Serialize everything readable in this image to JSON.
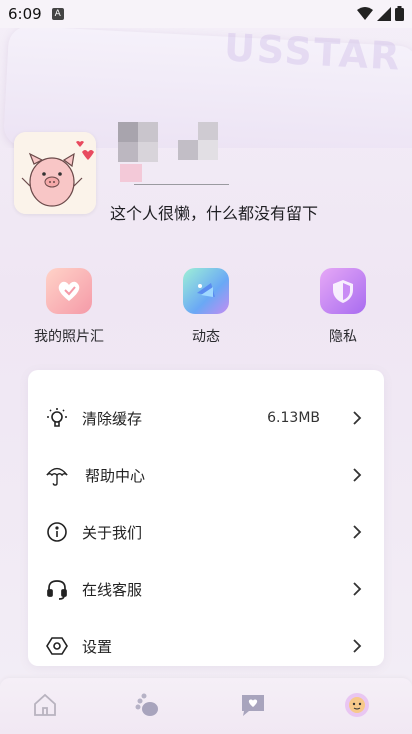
{
  "status_bar": {
    "time": "6:09",
    "app_icon": "A"
  },
  "banner": {
    "watermark_text": "USSTAR"
  },
  "profile": {
    "bio": "这个人很懒，什么都没有留下"
  },
  "quick_actions": [
    {
      "label": "我的照片汇",
      "icon": "photo-heart-icon",
      "color": "#f7a6b1"
    },
    {
      "label": "动态",
      "icon": "dynamic-icon",
      "color": "#7fd4e8"
    },
    {
      "label": "隐私",
      "icon": "shield-icon",
      "color": "#c68bf0"
    }
  ],
  "menu": {
    "items": [
      {
        "label": "清除缓存",
        "value": "6.13MB",
        "icon": "lightbulb-icon"
      },
      {
        "label": "帮助中心",
        "value": "",
        "icon": "umbrella-icon"
      },
      {
        "label": "关于我们",
        "value": "",
        "icon": "info-icon"
      },
      {
        "label": "在线客服",
        "value": "",
        "icon": "headset-icon"
      },
      {
        "label": "设置",
        "value": "",
        "icon": "settings-icon"
      }
    ]
  },
  "tab_bar": {
    "tabs": [
      {
        "icon": "home-icon",
        "active": false
      },
      {
        "icon": "paw-icon",
        "active": false
      },
      {
        "icon": "message-heart-icon",
        "active": false
      },
      {
        "icon": "avatar-tab-icon",
        "active": true
      }
    ]
  },
  "colors": {
    "accent_pink": "#f7a6b1",
    "accent_purple": "#c68bf0",
    "accent_cyan": "#7fd4e8",
    "background": "#f4eff8"
  }
}
